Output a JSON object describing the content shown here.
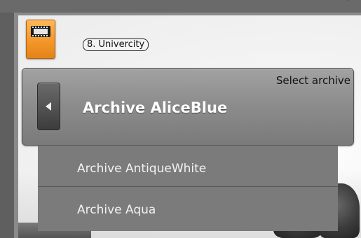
{
  "camera": {
    "label": "8. Univercity",
    "icon": "film-icon",
    "tile_color": "#f59a2e"
  },
  "archive_selector": {
    "hint": "Select archive",
    "current": "Archive AliceBlue",
    "prev_icon": "chevron-left-icon"
  },
  "dropdown": {
    "items": [
      {
        "label": "Archive AntiqueWhite"
      },
      {
        "label": "Archive Aqua"
      }
    ]
  }
}
